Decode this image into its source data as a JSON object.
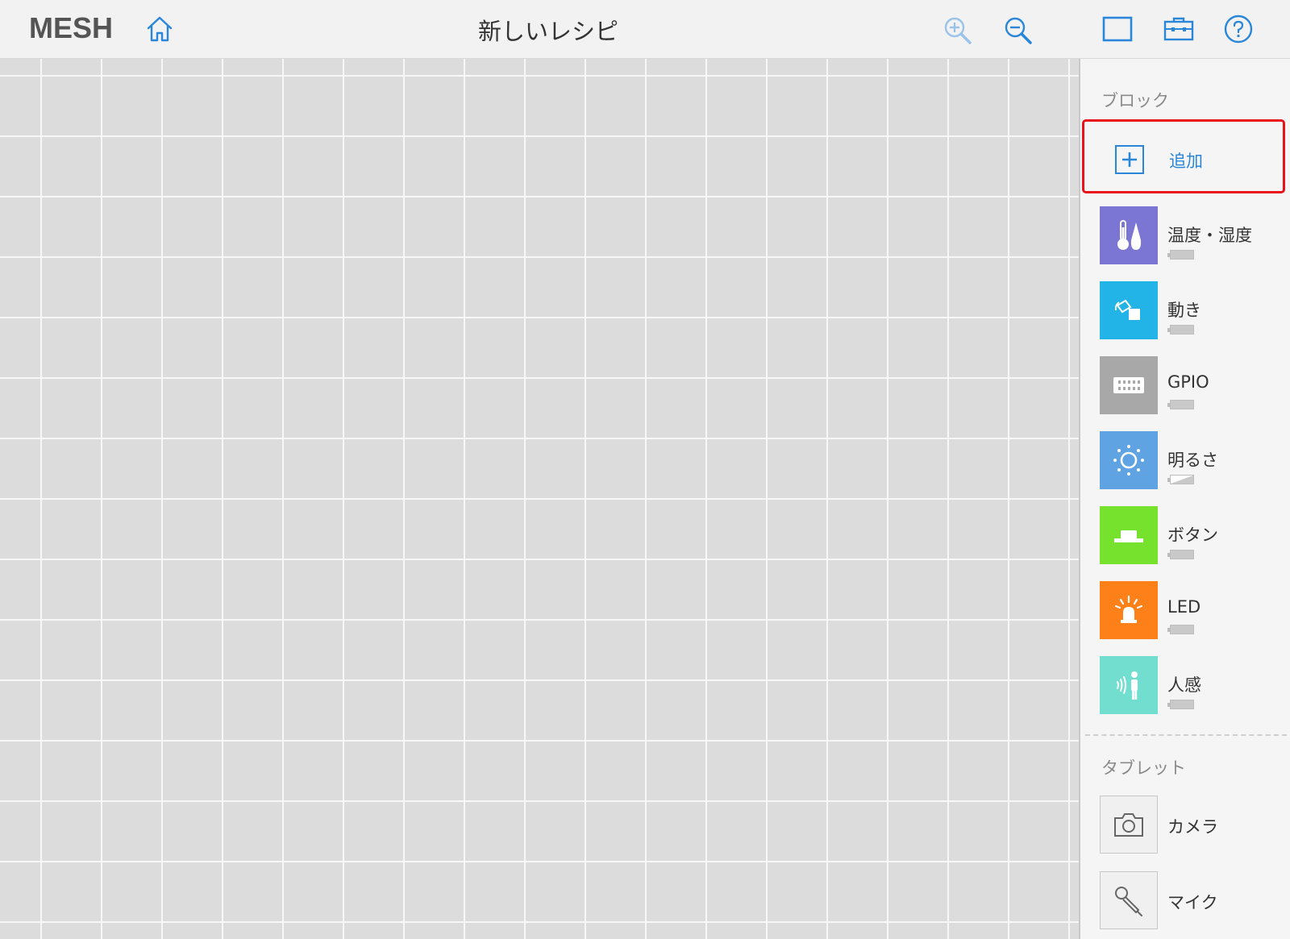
{
  "header": {
    "logo": "MESH",
    "title": "新しいレシピ"
  },
  "sidebar": {
    "blocks_heading": "ブロック",
    "add_label": "追加",
    "blocks": [
      {
        "label": "温度・湿度",
        "icon": "thermometer-droplet-icon",
        "color": "#7b75d3",
        "battery": "full"
      },
      {
        "label": "動き",
        "icon": "motion-icon",
        "color": "#22b4e6",
        "battery": "full"
      },
      {
        "label": "GPIO",
        "icon": "gpio-icon",
        "color": "#a8a8a8",
        "battery": "full"
      },
      {
        "label": "明るさ",
        "icon": "brightness-icon",
        "color": "#5fa3e3",
        "battery": "low"
      },
      {
        "label": "ボタン",
        "icon": "button-icon",
        "color": "#77e22d",
        "battery": "full"
      },
      {
        "label": "LED",
        "icon": "led-icon",
        "color": "#fd8018",
        "battery": "full"
      },
      {
        "label": "人感",
        "icon": "human-sensor-icon",
        "color": "#72ded0",
        "battery": "full"
      }
    ],
    "tablet_heading": "タブレット",
    "tablet": [
      {
        "label": "カメラ",
        "icon": "camera-icon"
      },
      {
        "label": "マイク",
        "icon": "microphone-icon"
      }
    ]
  },
  "colors": {
    "accent": "#2a86d8",
    "highlight": "#e8121a"
  }
}
